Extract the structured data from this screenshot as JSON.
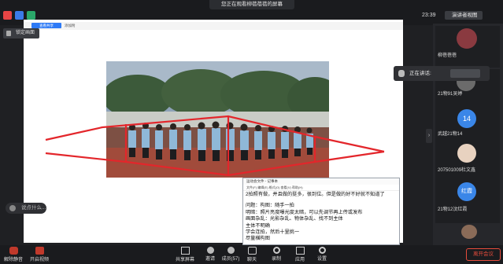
{
  "banner": {
    "text": "您正在观看柳蓓蓓蓓的屏幕"
  },
  "topbar": {
    "time": "23:39",
    "speaker_view": "演讲者视图"
  },
  "main": {
    "lock_label": "锁定画面",
    "share_tag": "查看共享",
    "toolbar_add": "添加附"
  },
  "notepad": {
    "title": "运动会文件 - 记事本",
    "menu": "文件(F)  编辑(E)  格式(O)  查看(V)  帮助(H)",
    "lines": [
      "2拍照有做，并且做的挺多，很到位。但是做的好不好就不知道了",
      "问题：构图：随手一拍",
      "       明暗：照片亮度曝光度太暗，可以先调节再上传或发布",
      "       画面杂乱：光影杂乱、物体杂乱、找不到主体",
      "       主体不明确",
      "学会连拍，然后十里挑一",
      "尽量横构图"
    ]
  },
  "chat": {
    "placeholder": "说点什么..."
  },
  "speaking": {
    "label": "正在讲话:"
  },
  "participants": [
    {
      "name": "柳蓓蓓蓓",
      "avatar_text": ""
    },
    {
      "name": "21物91吴婷",
      "avatar_text": ""
    },
    {
      "name": "武越21物14",
      "avatar_text": "14"
    },
    {
      "name": "207501009杜文鑫",
      "avatar_text": ""
    },
    {
      "name": "21物12汶红霞",
      "avatar_text": "红霞"
    }
  ],
  "bottom": {
    "mute": "解除静音",
    "video": "开启视频",
    "share": "共享屏幕",
    "invite": "邀请",
    "members": "成员(57)",
    "chat": "聊天",
    "record": "录制",
    "apps": "应用",
    "settings": "设置",
    "end": "离开会议"
  },
  "colors": {
    "accent": "#2d7af6",
    "danger": "#e74c3c"
  }
}
